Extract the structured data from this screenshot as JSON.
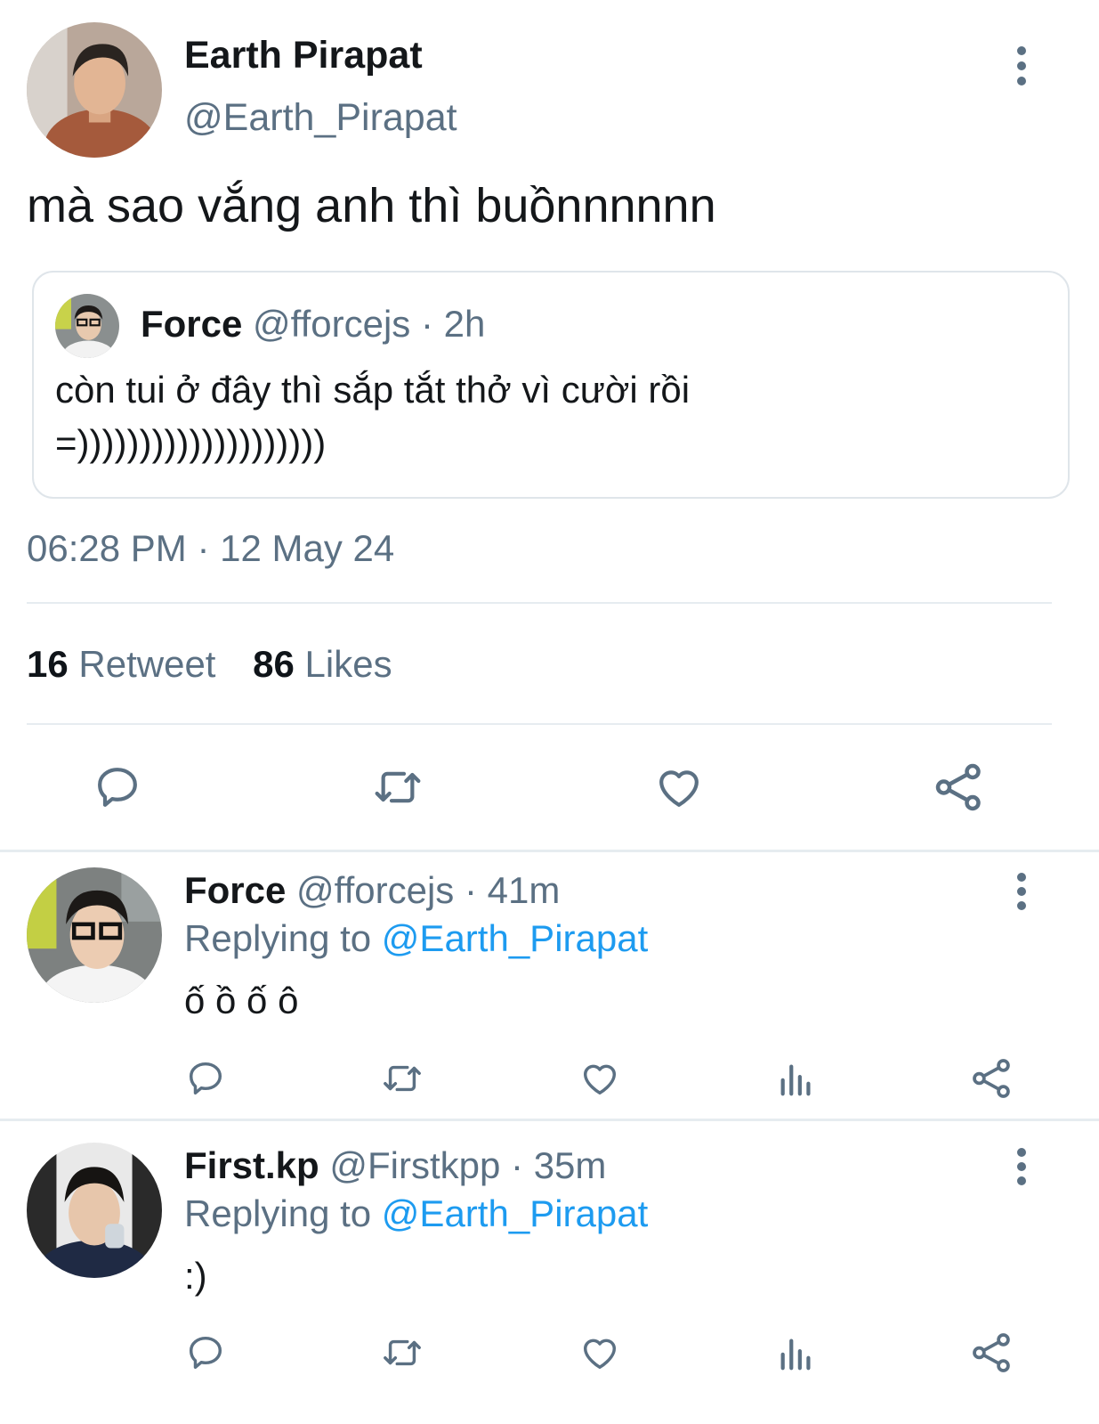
{
  "main_tweet": {
    "author_name": "Earth Pirapat",
    "author_handle": "@Earth_Pirapat",
    "text": "mà sao vắng anh thì buồnnnnnn",
    "timestamp": "06:28 PM · 12 May 24",
    "quoted": {
      "author_name": "Force",
      "meta": "@fforcejs · 2h",
      "text_line1": "còn tui ở đây thì sắp tắt thở vì cười rồi",
      "text_line2": "=))))))))))))))))))))"
    },
    "stats": {
      "retweets_count": "16",
      "retweets_label": "Retweet",
      "likes_count": "86",
      "likes_label": "Likes"
    },
    "actions": [
      "reply-icon",
      "retweet-icon",
      "heart-icon",
      "share-icon"
    ]
  },
  "replies": [
    {
      "author_name": "Force",
      "meta": "@fforcejs · 41m",
      "replying_prefix": "Replying to",
      "replying_handle": "@Earth_Pirapat",
      "text": "ố ồ ố ô"
    },
    {
      "author_name": "First.kp",
      "meta": "@Firstkpp · 35m",
      "replying_prefix": "Replying to",
      "replying_handle": "@Earth_Pirapat",
      "text": ":)"
    }
  ],
  "colors": {
    "accent": "#1d9bf0",
    "secondary_text": "#5b7083",
    "icon": "#5b7083",
    "divider": "#e6ecf0"
  }
}
